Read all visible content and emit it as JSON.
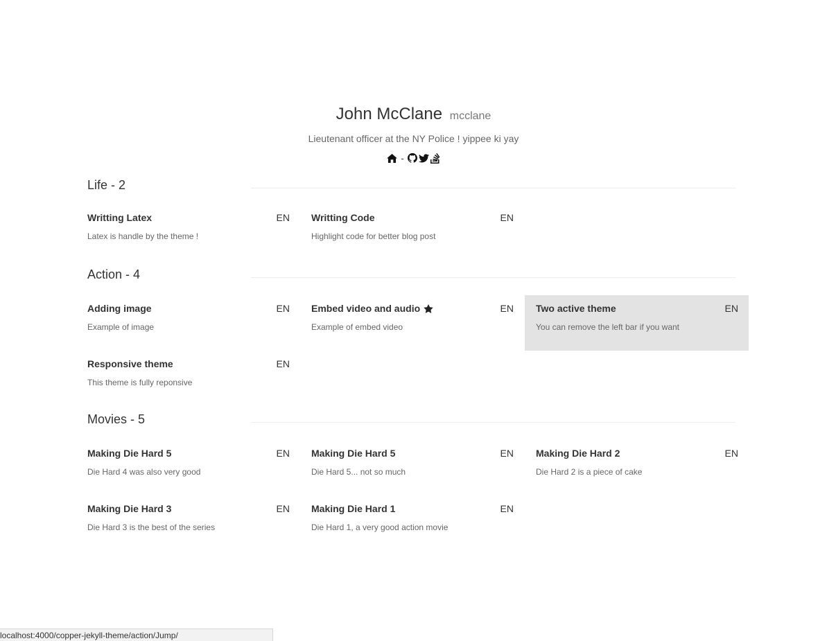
{
  "profile": {
    "name": "John McClane",
    "handle": "mcclane",
    "bio": "Lieutenant officer at the NY Police ! yippee ki yay",
    "separator": "-",
    "icons": [
      "home-icon",
      "github-icon",
      "twitter-icon",
      "stackoverflow-icon"
    ]
  },
  "sections": [
    {
      "title": "Life - 2",
      "posts": [
        {
          "title": "Writting Latex",
          "lang": "EN",
          "desc": "Latex is handle by the theme !"
        },
        {
          "title": "Writting Code",
          "lang": "EN",
          "desc": "Highlight code for better blog post"
        }
      ]
    },
    {
      "title": "Action - 4",
      "posts": [
        {
          "title": "Adding image",
          "lang": "EN",
          "desc": "Example of image"
        },
        {
          "title": "Embed video and audio",
          "lang": "EN",
          "desc": "Example of embed video",
          "starred": true
        },
        {
          "title": "Two active theme",
          "lang": "EN",
          "desc": "You can remove the left bar if you want",
          "active": true
        },
        {
          "title": "Responsive theme",
          "lang": "EN",
          "desc": "This theme is fully reponsive"
        }
      ]
    },
    {
      "title": "Movies - 5",
      "posts": [
        {
          "title": "Making Die Hard 5",
          "lang": "EN",
          "desc": "Die Hard 4 was also very good"
        },
        {
          "title": "Making Die Hard 5",
          "lang": "EN",
          "desc": "Die Hard 5... not so much"
        },
        {
          "title": "Making Die Hard 2",
          "lang": "EN",
          "desc": "Die Hard 2 is a piece of cake"
        },
        {
          "title": "Making Die Hard 3",
          "lang": "EN",
          "desc": "Die Hard 3 is the best of the series"
        },
        {
          "title": "Making Die Hard 1",
          "lang": "EN",
          "desc": "Die Hard 1, a very good action movie"
        }
      ]
    }
  ],
  "statusbar": {
    "url": "localhost:4000/copper-jekyll-theme/action/Jump/"
  },
  "colors": {
    "active_card_bg": "#e3e3e3",
    "text": "#333333",
    "muted": "#666666"
  }
}
